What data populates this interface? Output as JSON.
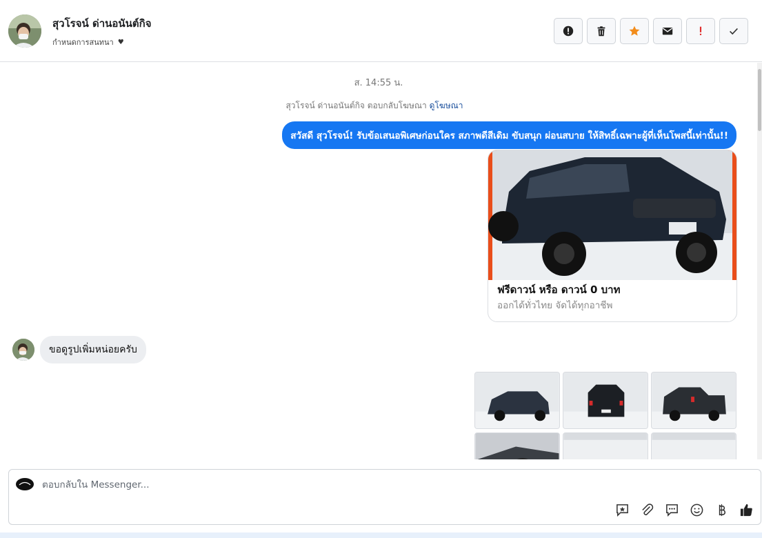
{
  "header": {
    "contact_name": "สุวโรจน์ ด่านอนันต์กิจ",
    "assign_label": "กำหนดการสนทนา",
    "actions": [
      {
        "name": "report-button",
        "icon": "exclamation-circle-icon"
      },
      {
        "name": "delete-button",
        "icon": "trash-icon"
      },
      {
        "name": "star-button",
        "icon": "star-icon"
      },
      {
        "name": "mark-unread-button",
        "icon": "envelope-icon"
      },
      {
        "name": "important-button",
        "icon": "exclamation-icon"
      },
      {
        "name": "done-button",
        "icon": "check-icon"
      }
    ]
  },
  "conversation": {
    "timestamp": "ส. 14:55 น.",
    "reply_note_prefix": "สุวโรจน์ ด่านอนันต์กิจ ตอบกลับโฆษณา",
    "reply_note_link": "ดูโฆษณา",
    "outgoing_message": "สวัสดี สุวโรจน์! รับข้อเสนอพิเศษก่อนใคร สภาพดีสีเดิม ขับสนุก ผ่อนสบาย ให้สิทธิ์เฉพาะผู้ที่เห็นโพสนี้เท่านั้น!!",
    "ad_card": {
      "title": "ฟรีดาวน์ หรือ ดาวน์ 0 บาท",
      "description": "ออกได้ทั่วไทย จัดได้ทุกอาชีพ"
    },
    "incoming_message": "ขอดูรูปเพิ่มหน่อยครับ"
  },
  "composer": {
    "placeholder": "ตอบกลับใน Messenger...",
    "tools": [
      "saved-reply-icon",
      "attachment-icon",
      "chat-icon",
      "emoji-icon",
      "baht-icon",
      "like-icon"
    ]
  },
  "colors": {
    "accent_blue": "#1677f2",
    "star_orange": "#f28c1b",
    "alert_red": "#e02d2d"
  }
}
